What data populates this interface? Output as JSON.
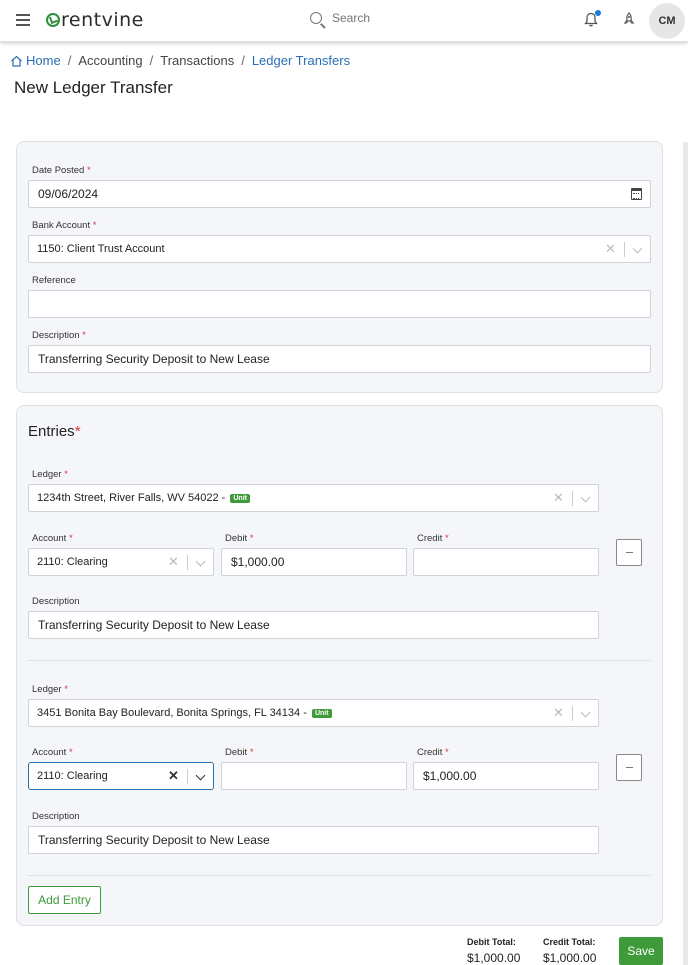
{
  "app": {
    "logo_text": "rentvine",
    "search_placeholder": "Search",
    "avatar_initials": "CM"
  },
  "breadcrumb": {
    "home": "Home",
    "accounting": "Accounting",
    "transactions": "Transactions",
    "current": "Ledger Transfers",
    "separator": "/"
  },
  "page_title": "New Ledger Transfer",
  "form": {
    "date_posted_label": "Date Posted",
    "date_posted_value": "09/06/2024",
    "bank_account_label": "Bank Account",
    "bank_account_value": "1150: Client Trust Account",
    "reference_label": "Reference",
    "reference_value": "",
    "description_label": "Description",
    "description_value": "Transferring Security Deposit to New Lease",
    "required_mark": "*"
  },
  "entries": {
    "title": "Entries",
    "items": [
      {
        "ledger_label": "Ledger",
        "ledger_value": "1234th Street, River Falls, WV 54022 -",
        "ledger_badge": "Unit",
        "account_label": "Account",
        "account_value": "2110: Clearing",
        "debit_label": "Debit",
        "debit_value": "$1,000.00",
        "credit_label": "Credit",
        "credit_value": "",
        "description_label": "Description",
        "description_value": "Transferring Security Deposit to New Lease"
      },
      {
        "ledger_label": "Ledger",
        "ledger_value": "3451 Bonita Bay Boulevard, Bonita Springs, FL 34134 -",
        "ledger_badge": "Unit",
        "account_label": "Account",
        "account_value": "2110: Clearing",
        "debit_label": "Debit",
        "debit_value": "",
        "credit_label": "Credit",
        "credit_value": "$1,000.00",
        "description_label": "Description",
        "description_value": "Transferring Security Deposit to New Lease"
      }
    ],
    "add_entry_label": "Add Entry"
  },
  "totals": {
    "debit_label": "Debit Total:",
    "debit_value": "$1,000.00",
    "credit_label": "Credit Total:",
    "credit_value": "$1,000.00"
  },
  "save_label": "Save",
  "colors": {
    "accent_green": "#3f9b3a",
    "link_blue": "#2a6fb5",
    "required_red": "#d23c3c"
  }
}
